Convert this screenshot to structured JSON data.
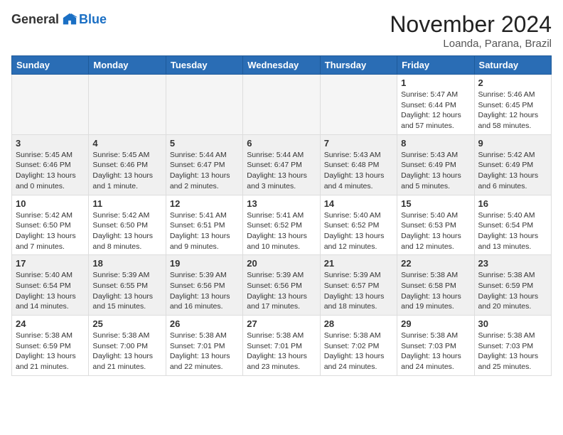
{
  "header": {
    "logo_general": "General",
    "logo_blue": "Blue",
    "month_title": "November 2024",
    "location": "Loanda, Parana, Brazil"
  },
  "weekdays": [
    "Sunday",
    "Monday",
    "Tuesday",
    "Wednesday",
    "Thursday",
    "Friday",
    "Saturday"
  ],
  "weeks": [
    [
      {
        "day": "",
        "empty": true
      },
      {
        "day": "",
        "empty": true
      },
      {
        "day": "",
        "empty": true
      },
      {
        "day": "",
        "empty": true
      },
      {
        "day": "",
        "empty": true
      },
      {
        "day": "1",
        "sunrise": "Sunrise: 5:47 AM",
        "sunset": "Sunset: 6:44 PM",
        "daylight": "Daylight: 12 hours and 57 minutes."
      },
      {
        "day": "2",
        "sunrise": "Sunrise: 5:46 AM",
        "sunset": "Sunset: 6:45 PM",
        "daylight": "Daylight: 12 hours and 58 minutes."
      }
    ],
    [
      {
        "day": "3",
        "sunrise": "Sunrise: 5:45 AM",
        "sunset": "Sunset: 6:46 PM",
        "daylight": "Daylight: 13 hours and 0 minutes."
      },
      {
        "day": "4",
        "sunrise": "Sunrise: 5:45 AM",
        "sunset": "Sunset: 6:46 PM",
        "daylight": "Daylight: 13 hours and 1 minute."
      },
      {
        "day": "5",
        "sunrise": "Sunrise: 5:44 AM",
        "sunset": "Sunset: 6:47 PM",
        "daylight": "Daylight: 13 hours and 2 minutes."
      },
      {
        "day": "6",
        "sunrise": "Sunrise: 5:44 AM",
        "sunset": "Sunset: 6:47 PM",
        "daylight": "Daylight: 13 hours and 3 minutes."
      },
      {
        "day": "7",
        "sunrise": "Sunrise: 5:43 AM",
        "sunset": "Sunset: 6:48 PM",
        "daylight": "Daylight: 13 hours and 4 minutes."
      },
      {
        "day": "8",
        "sunrise": "Sunrise: 5:43 AM",
        "sunset": "Sunset: 6:49 PM",
        "daylight": "Daylight: 13 hours and 5 minutes."
      },
      {
        "day": "9",
        "sunrise": "Sunrise: 5:42 AM",
        "sunset": "Sunset: 6:49 PM",
        "daylight": "Daylight: 13 hours and 6 minutes."
      }
    ],
    [
      {
        "day": "10",
        "sunrise": "Sunrise: 5:42 AM",
        "sunset": "Sunset: 6:50 PM",
        "daylight": "Daylight: 13 hours and 7 minutes."
      },
      {
        "day": "11",
        "sunrise": "Sunrise: 5:42 AM",
        "sunset": "Sunset: 6:50 PM",
        "daylight": "Daylight: 13 hours and 8 minutes."
      },
      {
        "day": "12",
        "sunrise": "Sunrise: 5:41 AM",
        "sunset": "Sunset: 6:51 PM",
        "daylight": "Daylight: 13 hours and 9 minutes."
      },
      {
        "day": "13",
        "sunrise": "Sunrise: 5:41 AM",
        "sunset": "Sunset: 6:52 PM",
        "daylight": "Daylight: 13 hours and 10 minutes."
      },
      {
        "day": "14",
        "sunrise": "Sunrise: 5:40 AM",
        "sunset": "Sunset: 6:52 PM",
        "daylight": "Daylight: 13 hours and 12 minutes."
      },
      {
        "day": "15",
        "sunrise": "Sunrise: 5:40 AM",
        "sunset": "Sunset: 6:53 PM",
        "daylight": "Daylight: 13 hours and 12 minutes."
      },
      {
        "day": "16",
        "sunrise": "Sunrise: 5:40 AM",
        "sunset": "Sunset: 6:54 PM",
        "daylight": "Daylight: 13 hours and 13 minutes."
      }
    ],
    [
      {
        "day": "17",
        "sunrise": "Sunrise: 5:40 AM",
        "sunset": "Sunset: 6:54 PM",
        "daylight": "Daylight: 13 hours and 14 minutes."
      },
      {
        "day": "18",
        "sunrise": "Sunrise: 5:39 AM",
        "sunset": "Sunset: 6:55 PM",
        "daylight": "Daylight: 13 hours and 15 minutes."
      },
      {
        "day": "19",
        "sunrise": "Sunrise: 5:39 AM",
        "sunset": "Sunset: 6:56 PM",
        "daylight": "Daylight: 13 hours and 16 minutes."
      },
      {
        "day": "20",
        "sunrise": "Sunrise: 5:39 AM",
        "sunset": "Sunset: 6:56 PM",
        "daylight": "Daylight: 13 hours and 17 minutes."
      },
      {
        "day": "21",
        "sunrise": "Sunrise: 5:39 AM",
        "sunset": "Sunset: 6:57 PM",
        "daylight": "Daylight: 13 hours and 18 minutes."
      },
      {
        "day": "22",
        "sunrise": "Sunrise: 5:38 AM",
        "sunset": "Sunset: 6:58 PM",
        "daylight": "Daylight: 13 hours and 19 minutes."
      },
      {
        "day": "23",
        "sunrise": "Sunrise: 5:38 AM",
        "sunset": "Sunset: 6:59 PM",
        "daylight": "Daylight: 13 hours and 20 minutes."
      }
    ],
    [
      {
        "day": "24",
        "sunrise": "Sunrise: 5:38 AM",
        "sunset": "Sunset: 6:59 PM",
        "daylight": "Daylight: 13 hours and 21 minutes."
      },
      {
        "day": "25",
        "sunrise": "Sunrise: 5:38 AM",
        "sunset": "Sunset: 7:00 PM",
        "daylight": "Daylight: 13 hours and 21 minutes."
      },
      {
        "day": "26",
        "sunrise": "Sunrise: 5:38 AM",
        "sunset": "Sunset: 7:01 PM",
        "daylight": "Daylight: 13 hours and 22 minutes."
      },
      {
        "day": "27",
        "sunrise": "Sunrise: 5:38 AM",
        "sunset": "Sunset: 7:01 PM",
        "daylight": "Daylight: 13 hours and 23 minutes."
      },
      {
        "day": "28",
        "sunrise": "Sunrise: 5:38 AM",
        "sunset": "Sunset: 7:02 PM",
        "daylight": "Daylight: 13 hours and 24 minutes."
      },
      {
        "day": "29",
        "sunrise": "Sunrise: 5:38 AM",
        "sunset": "Sunset: 7:03 PM",
        "daylight": "Daylight: 13 hours and 24 minutes."
      },
      {
        "day": "30",
        "sunrise": "Sunrise: 5:38 AM",
        "sunset": "Sunset: 7:03 PM",
        "daylight": "Daylight: 13 hours and 25 minutes."
      }
    ]
  ]
}
